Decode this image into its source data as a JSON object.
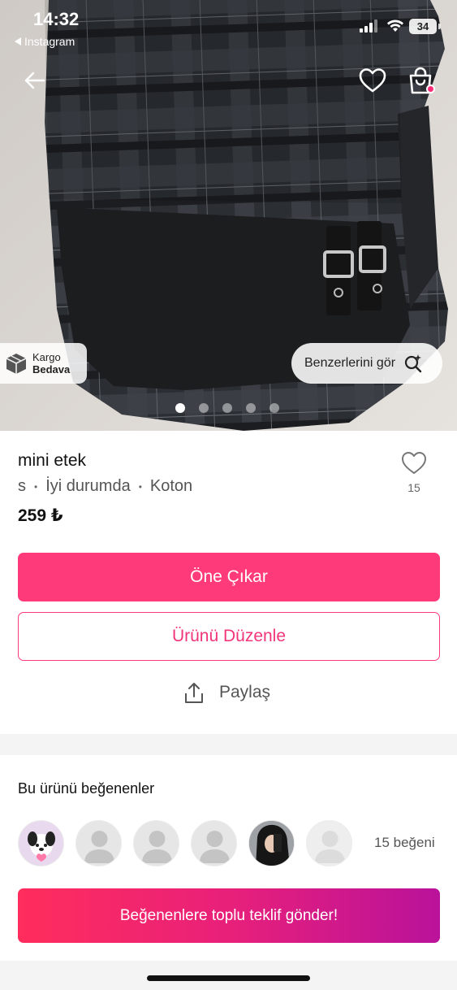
{
  "status_bar": {
    "time": "14:32",
    "back_app": "Instagram",
    "battery": "34"
  },
  "nav": {
    "back_icon": "arrow-left-icon",
    "favorite_icon": "heart-icon",
    "bag_icon": "shopping-bag-icon"
  },
  "photo": {
    "badge_label_1": "Kargo",
    "badge_label_2": "Bedava",
    "similar_label": "Benzerlerini gör",
    "slide_count": 5,
    "active_slide": 1
  },
  "product": {
    "title": "mini etek",
    "size": "s",
    "condition": "İyi durumda",
    "brand": "Koton",
    "price": "259 ₺",
    "like_count": "15"
  },
  "actions": {
    "boost_label": "Öne Çıkar",
    "edit_label": "Ürünü Düzenle",
    "share_label": "Paylaş"
  },
  "likers": {
    "title": "Bu ürünü beğenenler",
    "count_label": "15 beğeni",
    "offer_label": "Beğenenlere toplu teklif gönder!"
  },
  "colors": {
    "accent": "#ff3a7a",
    "gradient_start": "#ff2d5c",
    "gradient_end": "#b9129a"
  }
}
